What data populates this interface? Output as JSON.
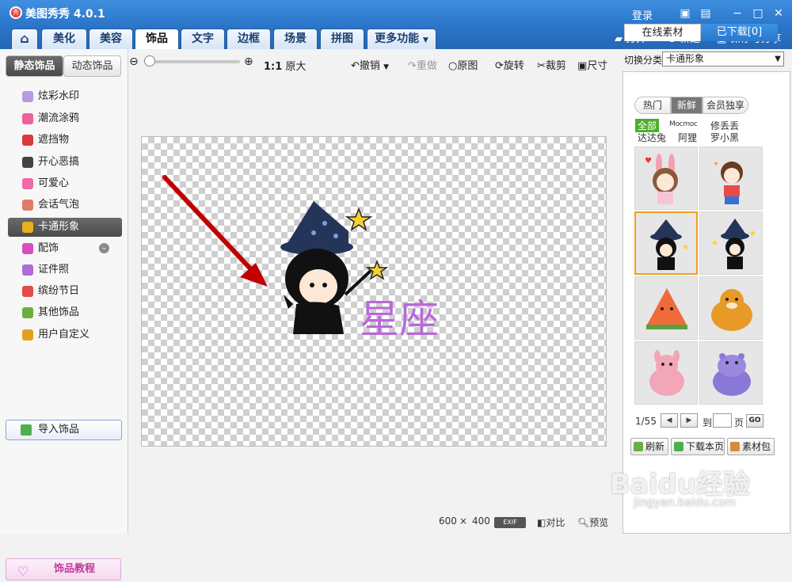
{
  "app": {
    "title": "美图秀秀 4.0.1"
  },
  "titlebar": {
    "login": "登录"
  },
  "tabs": [
    "美化",
    "美容",
    "饰品",
    "文字",
    "边框",
    "场景",
    "拼图",
    "更多功能"
  ],
  "tab_actions": {
    "open": "打开",
    "new": "新建",
    "save_share": "保存与分享"
  },
  "left": {
    "subtabs": [
      "静态饰品",
      "动态饰品"
    ],
    "items": [
      "炫彩水印",
      "潮流涂鸦",
      "遮挡物",
      "开心恶搞",
      "可爱心",
      "会话气泡",
      "卡通形象",
      "配饰",
      "证件照",
      "缤纷节日",
      "其他饰品",
      "用户自定义"
    ],
    "item_colors": [
      "#b79be0",
      "#f0609a",
      "#d83a3a",
      "#444444",
      "#f06aa8",
      "#e27a6a",
      "#e6b020",
      "#d84ec0",
      "#b26ad8",
      "#e44a4a",
      "#6ab040",
      "#e2a020"
    ],
    "import_label": "导入饰品",
    "tutorial_label": "饰品教程"
  },
  "toolbar": {
    "zoom_label": "原大",
    "zoom_ratio": "1:1",
    "undo": "撤销",
    "redo": "重做",
    "original": "原图",
    "rotate": "旋转",
    "crop": "裁剪",
    "size": "尺寸"
  },
  "canvas": {
    "text": "星座"
  },
  "status": {
    "width": "600",
    "times": "×",
    "height": "400",
    "exif": "EXIF",
    "compare": "对比",
    "preview": "预览"
  },
  "right": {
    "switch_label": "切换分类",
    "category": "卡通形象",
    "tabs": [
      "在线素材",
      "已下载[0]"
    ],
    "filters": [
      "热门",
      "新鲜",
      "会员独享"
    ],
    "authors": [
      "全部",
      "Mocmoc",
      "修丢丢",
      "达达兔",
      "阿狸",
      "罗小黑"
    ],
    "page": "1/55",
    "goto_label": "到",
    "page_unit": "页",
    "go": "GO",
    "buttons": [
      "刷新",
      "下载本页",
      "素材包"
    ]
  },
  "watermark": {
    "main": "Baidu经验",
    "sub": "jingyan.baidu.com"
  },
  "colors": {
    "accent": "#2a74c8",
    "canvas_text": "#b86ad8",
    "arrow": "#c00000"
  }
}
